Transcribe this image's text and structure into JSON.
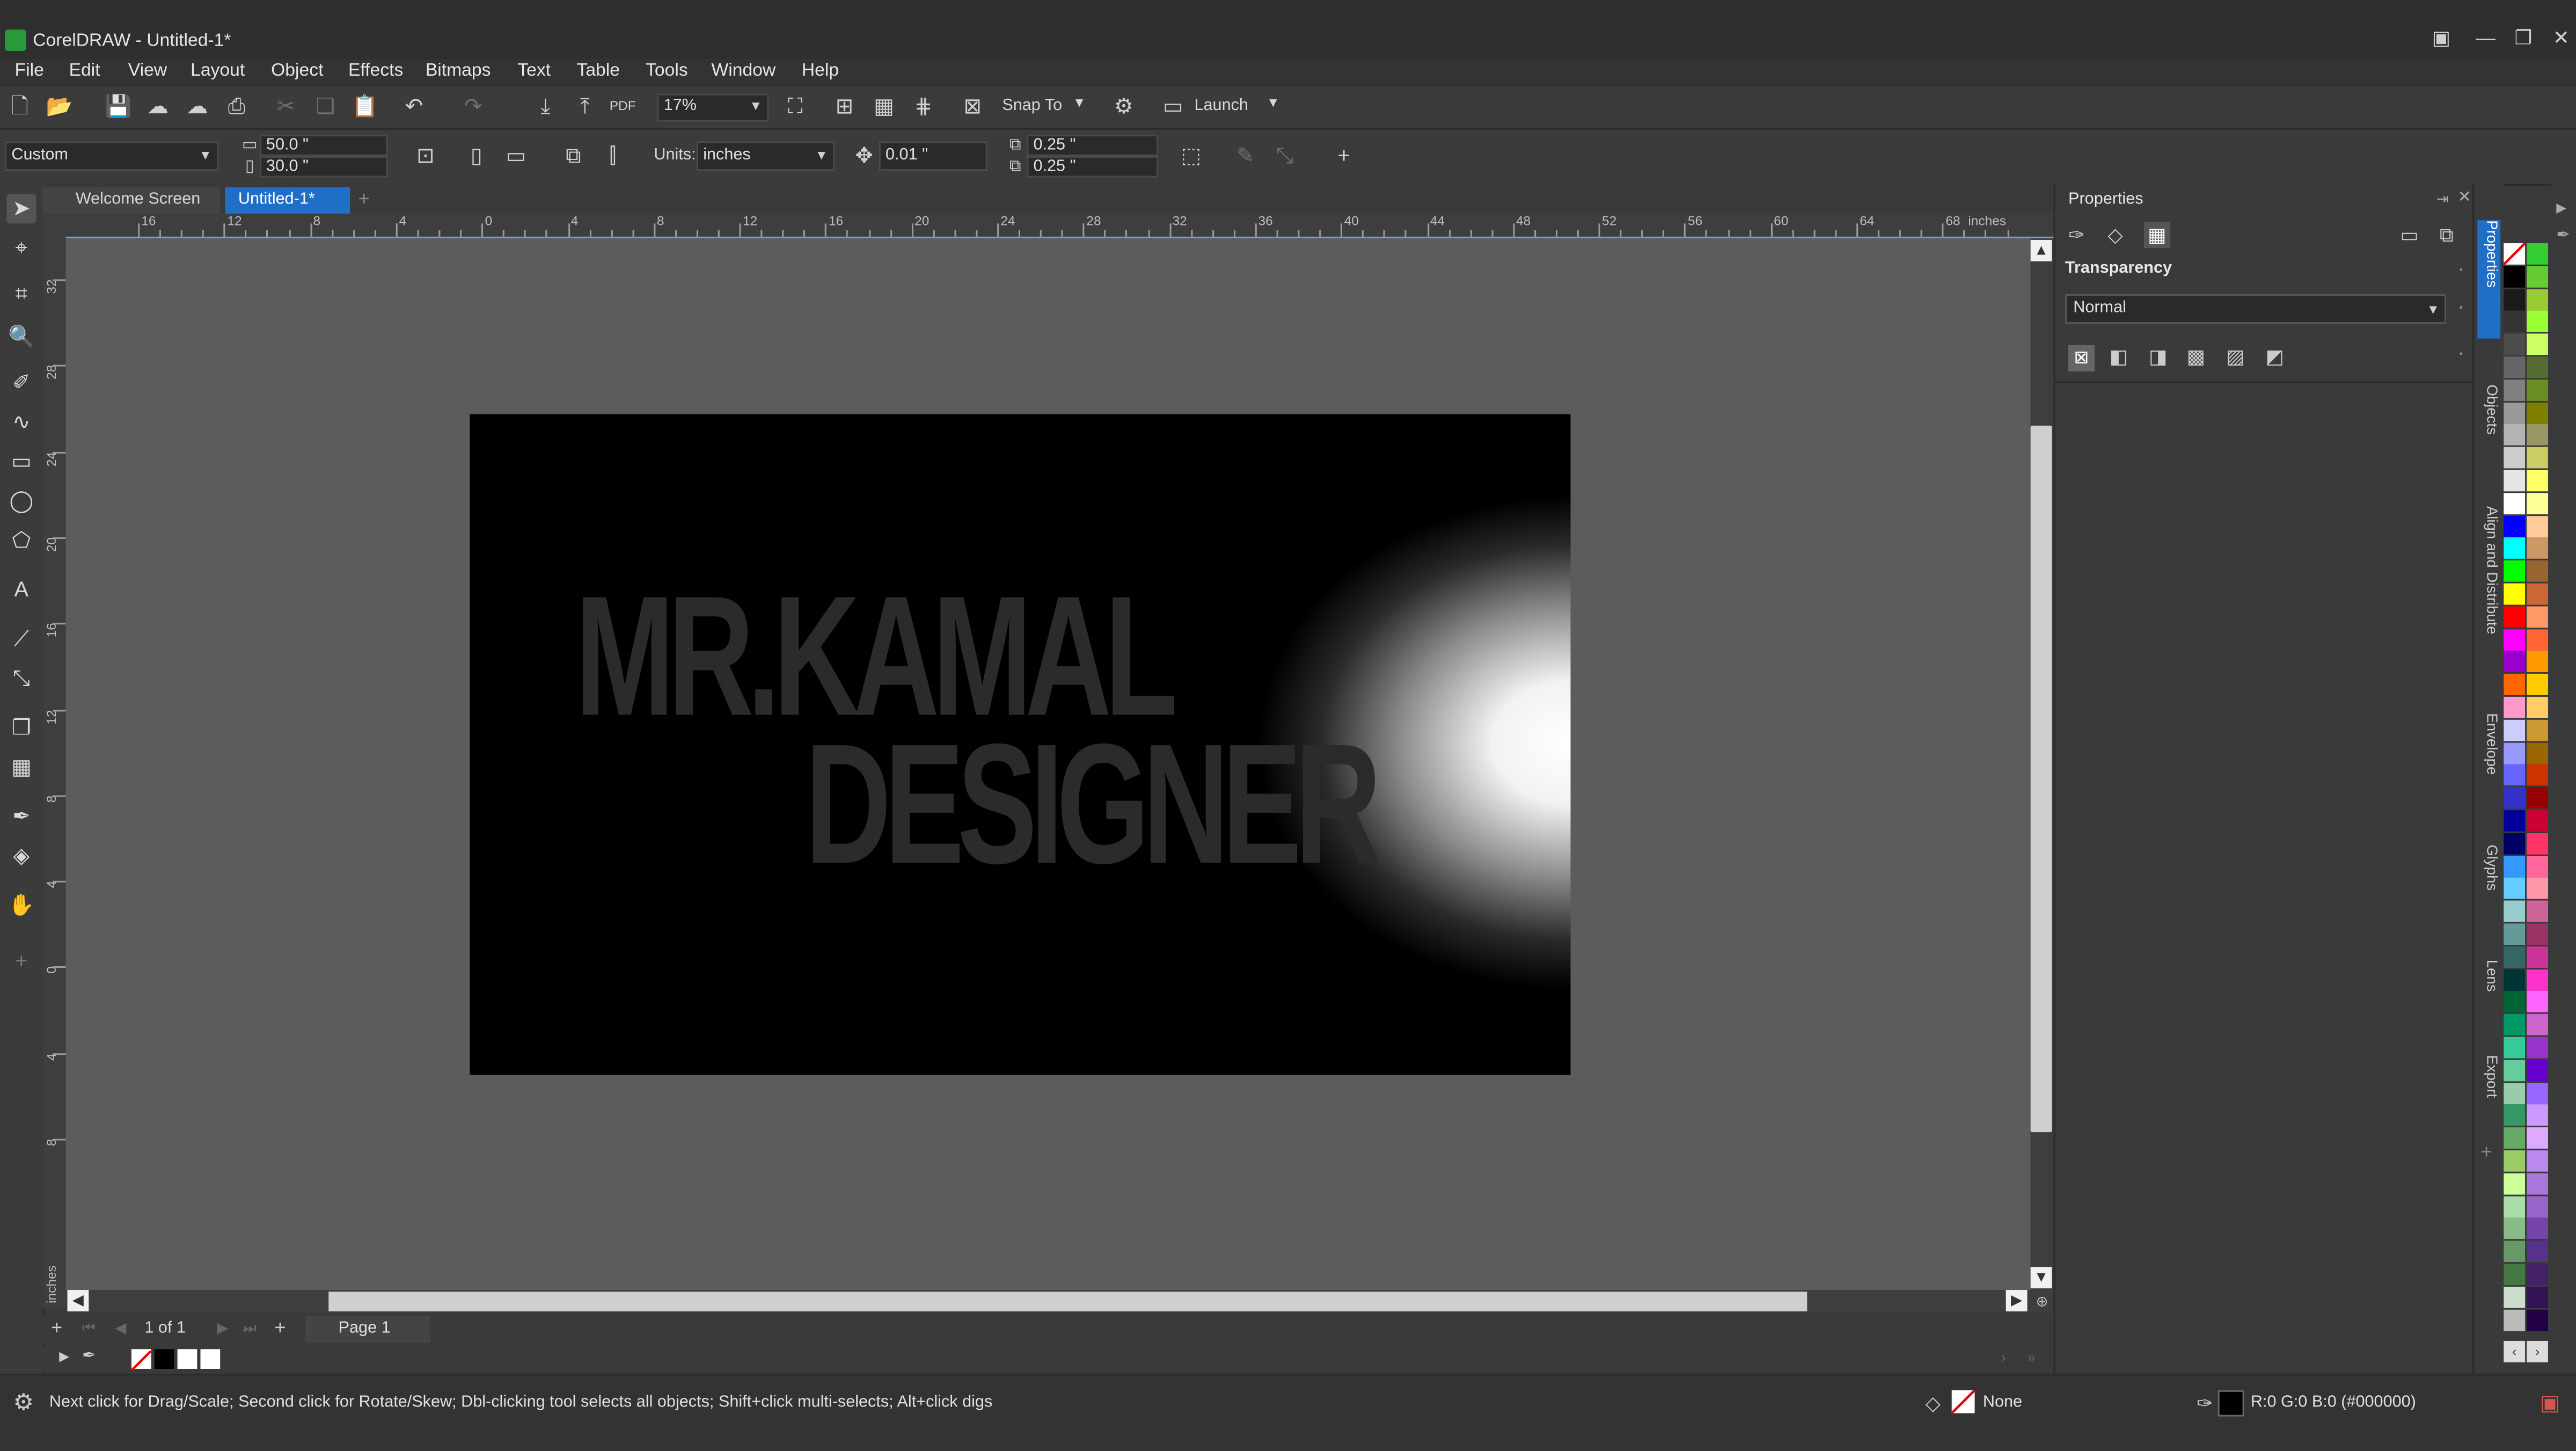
{
  "window": {
    "title": "CorelDRAW - Untitled-1*"
  },
  "menu": [
    "File",
    "Edit",
    "View",
    "Layout",
    "Object",
    "Effects",
    "Bitmaps",
    "Text",
    "Table",
    "Tools",
    "Window",
    "Help"
  ],
  "toolbar": {
    "zoom": "17%",
    "snap_label": "Snap To",
    "launch_label": "Launch"
  },
  "propertybar": {
    "preset": "Custom",
    "width": "50.0 \"",
    "height": "30.0 \"",
    "units_label": "Units:",
    "units_value": "inches",
    "nudge": "0.01 \"",
    "dup_x": "0.25 \"",
    "dup_y": "0.25 \""
  },
  "tabs": {
    "welcome": "Welcome Screen",
    "document": "Untitled-1*"
  },
  "ruler": {
    "unit": "inches",
    "ticks": [
      "16",
      "12",
      "8",
      "4",
      "0",
      "4",
      "8",
      "12",
      "16",
      "20",
      "24",
      "28",
      "32",
      "36",
      "40",
      "44",
      "48",
      "52",
      "56",
      "60",
      "64",
      "68"
    ],
    "v_ticks": [
      "32",
      "28",
      "24",
      "20",
      "16",
      "12",
      "8",
      "4",
      "0",
      "4",
      "8"
    ]
  },
  "artwork": {
    "line1": "MR.KAMAL",
    "line2": "DESIGNER"
  },
  "pagebar": {
    "page_count": "1 of 1",
    "page_tab": "Page 1"
  },
  "properties": {
    "title": "Properties",
    "section": "Transparency",
    "blend_mode": "Normal"
  },
  "docker_tabs": [
    "Properties",
    "Objects",
    "Align and Distribute",
    "Envelope",
    "Glyphs",
    "Lens",
    "Export"
  ],
  "palette_colors": [
    "#ffffff",
    "#000000",
    "#1a1a1a",
    "#333333",
    "#4d4d4d",
    "#666666",
    "#808080",
    "#999999",
    "#b3b3b3",
    "#cccccc",
    "#e6e6e6",
    "#ffffff",
    "#0000ff",
    "#00ffff",
    "#00ff00",
    "#ffff00",
    "#ff0000",
    "#ff00ff",
    "#9900cc",
    "#ff6600",
    "#ff99cc",
    "#ccccff",
    "#9999ff",
    "#6666ff",
    "#3333cc",
    "#000099",
    "#000066",
    "#3399ff",
    "#66ccff",
    "#99cccc",
    "#669999",
    "#336666",
    "#003333",
    "#006633",
    "#009966",
    "#33cc99",
    "#66cc99",
    "#99ccaa",
    "#339966",
    "#66aa66",
    "#99cc66",
    "#ccff99",
    "#aaddaa",
    "#88bb88",
    "#669966",
    "#447744",
    "#ccddcc",
    "#bbbbbb"
  ],
  "palette_colors_2": [
    "#33cc33",
    "#66cc33",
    "#99cc33",
    "#99ff33",
    "#ccff66",
    "#556b2f",
    "#6b8e23",
    "#808000",
    "#999966",
    "#cccc66",
    "#ffff66",
    "#ffff99",
    "#ffcc99",
    "#cc9966",
    "#996633",
    "#cc6633",
    "#ff9966",
    "#ff6633",
    "#ff9900",
    "#ffcc00",
    "#ffcc66",
    "#cc9933",
    "#996600",
    "#cc3300",
    "#990000",
    "#cc0033",
    "#ff3366",
    "#ff6699",
    "#ff99aa",
    "#cc6699",
    "#993366",
    "#cc3399",
    "#ff33cc",
    "#ff66ff",
    "#cc66cc",
    "#9933cc",
    "#6600cc",
    "#9966ff",
    "#cc99ff",
    "#ddaaff",
    "#bb88ee",
    "#aa77dd",
    "#9966cc",
    "#7744aa",
    "#553388",
    "#442266",
    "#331155",
    "#220044"
  ],
  "status": {
    "hint": "Next click for Drag/Scale; Second click for Rotate/Skew; Dbl-clicking tool selects all objects; Shift+click multi-selects; Alt+click digs",
    "fill_label": "None",
    "outline_label": "R:0 G:0 B:0 (#000000)"
  }
}
